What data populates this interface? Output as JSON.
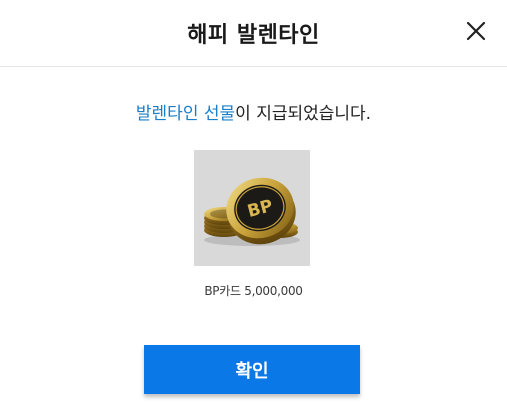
{
  "dialog": {
    "title": "해피 발렌타인",
    "close_icon": "close-icon"
  },
  "message": {
    "highlight": "발렌타인 선물",
    "rest": "이 지급되었습니다."
  },
  "reward": {
    "image_icon": "bp-coins-icon",
    "coin_text": "BP",
    "name": "BP카드 5,000,000"
  },
  "actions": {
    "confirm_label": "확인"
  },
  "colors": {
    "accent": "#0a78e6",
    "highlight_text": "#1a7fc8",
    "item_background": "#d9d9d9"
  }
}
